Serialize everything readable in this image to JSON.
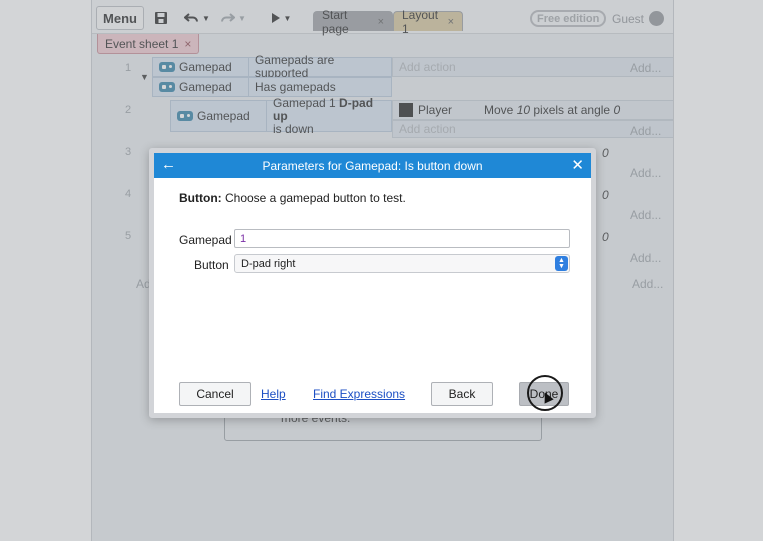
{
  "toolbar": {
    "menu_label": "Menu",
    "save_icon": "save-icon",
    "undo_icon": "undo-icon",
    "redo_icon": "redo-icon",
    "play_icon": "play-icon",
    "tabs": [
      {
        "label": "Start page",
        "close": "×"
      },
      {
        "label": "Layout 1",
        "close": "×"
      }
    ],
    "free_edition": "Free edition",
    "user": "Guest"
  },
  "sheet_tab": {
    "label": "Event sheet 1",
    "close": "×"
  },
  "events": {
    "row1": {
      "number": "1",
      "conditions": [
        {
          "object": "Gamepad",
          "text": "Gamepads are supported"
        },
        {
          "object": "Gamepad",
          "text": "Has gamepads"
        }
      ],
      "add_action": "Add action",
      "add": "Add..."
    },
    "row2": {
      "number": "2",
      "condition": {
        "object": "Gamepad",
        "text_prefix": "Gamepad 1 ",
        "text_bold": "D-pad up",
        "text_suffix": "is down"
      },
      "action": {
        "object": "Player",
        "text_prefix": "Move ",
        "value1": "10",
        "text_middle": " pixels at angle ",
        "value2": "0"
      },
      "add_action": "Add action",
      "add": "Add..."
    },
    "row3": {
      "number": "3",
      "angle": "0",
      "add": "Add..."
    },
    "row4": {
      "number": "4",
      "angle": "0",
      "add": "Add..."
    },
    "row5": {
      "number": "5",
      "angle": "0",
      "add": "Add..."
    },
    "add_event_partial": "Ad",
    "add_right": "Add...",
    "more_events": "more events."
  },
  "dialog": {
    "title": "Parameters for Gamepad: Is button down",
    "description_bold": "Button:",
    "description": " Choose a gamepad button to test.",
    "gamepad_label": "Gamepad",
    "gamepad_value": "1",
    "button_label": "Button",
    "button_value": "D-pad right",
    "cancel": "Cancel",
    "help": "Help",
    "find_expressions": "Find Expressions",
    "back": "Back",
    "done": "Done"
  }
}
